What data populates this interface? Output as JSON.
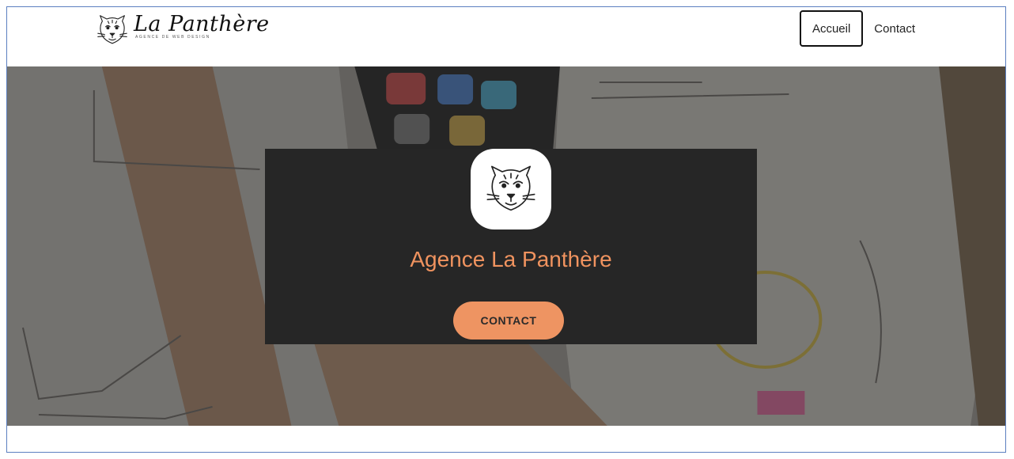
{
  "header": {
    "logo_title": "La Panthère",
    "logo_subtitle": "AGENCE DE WEB DESIGN",
    "logo_icon": "panther-head-icon"
  },
  "nav": {
    "items": [
      {
        "label": "Accueil",
        "active": true
      },
      {
        "label": "Contact",
        "active": false
      }
    ]
  },
  "hero": {
    "title": "Agence La Panthère",
    "button_label": "CONTACT",
    "logo_icon": "panther-head-icon",
    "accent_color": "#ee9462",
    "card_color": "#262626"
  }
}
